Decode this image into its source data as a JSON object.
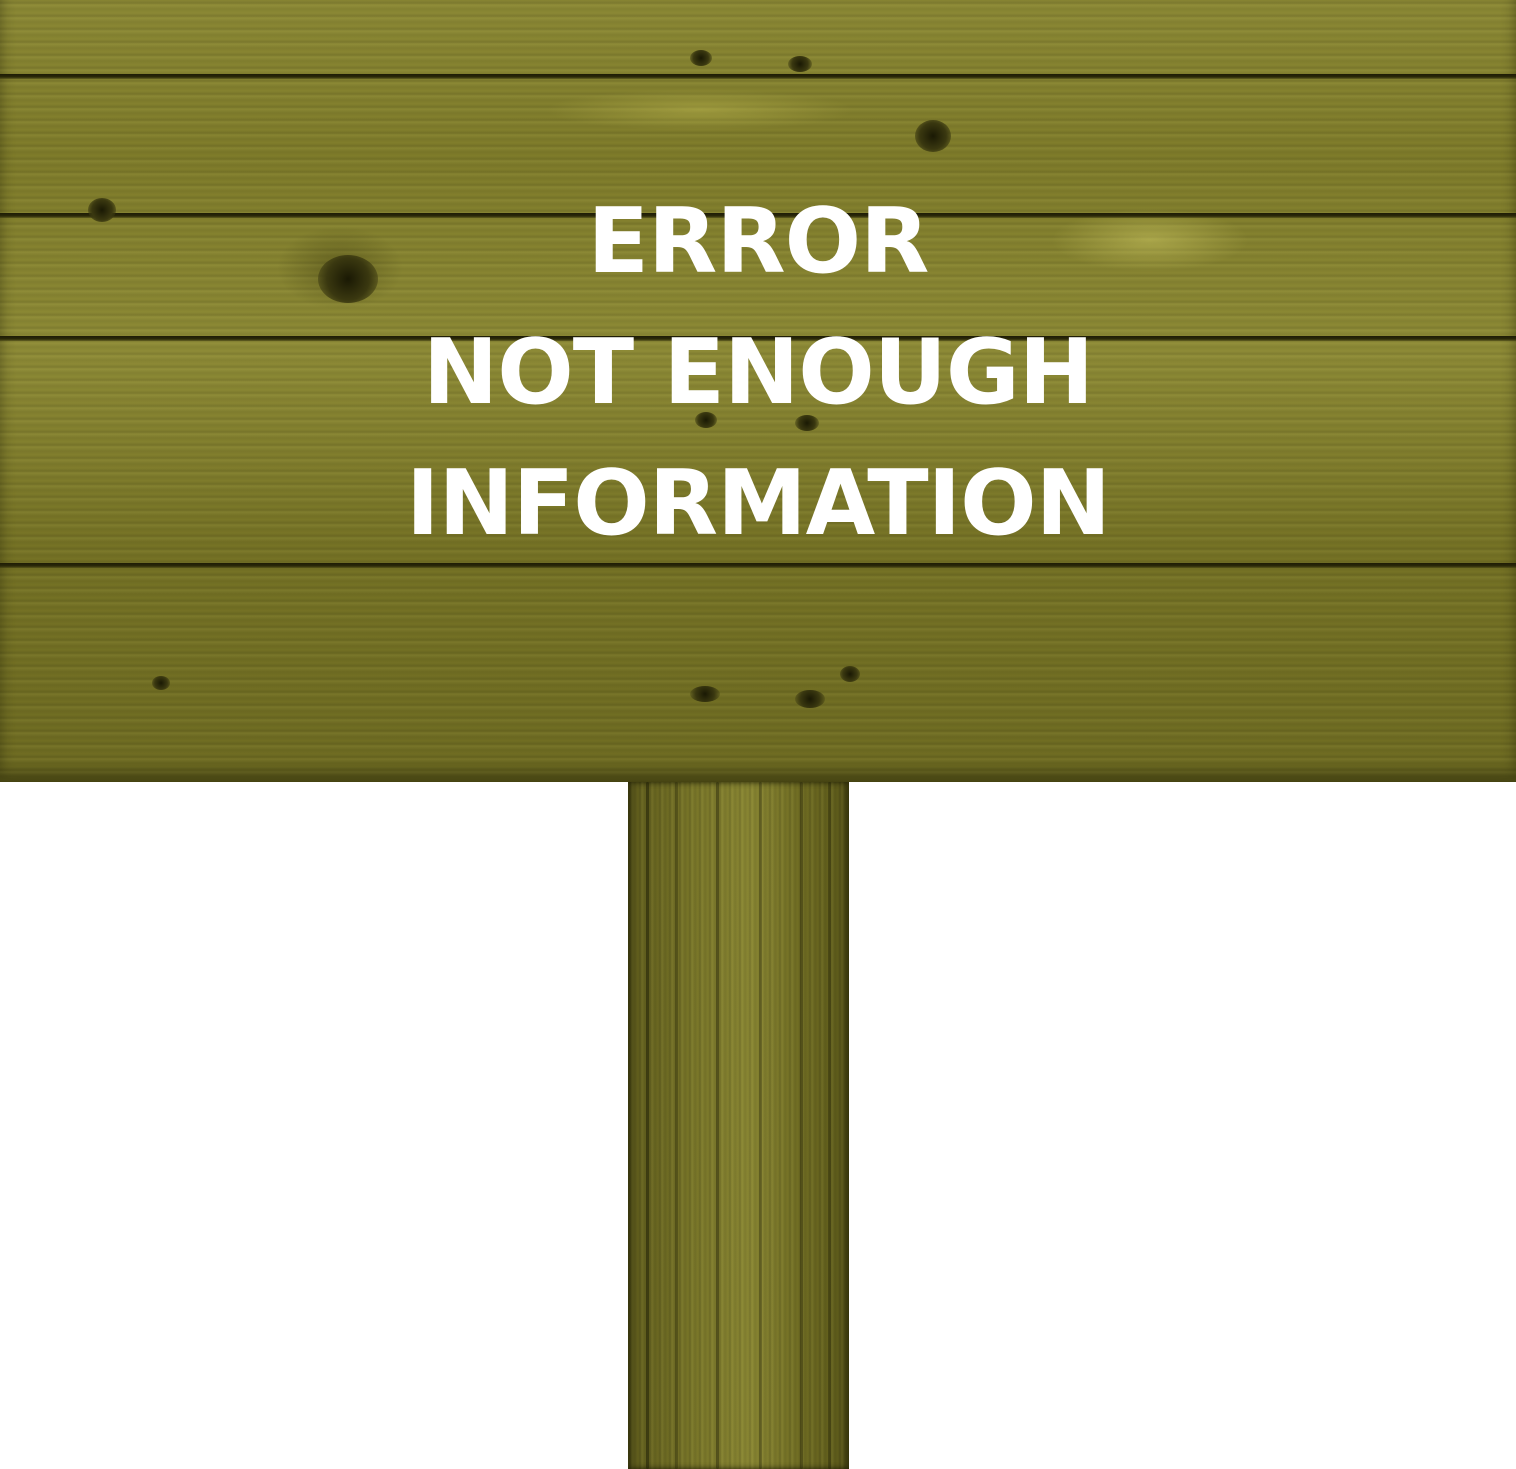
{
  "sign": {
    "line1": "ERROR",
    "line2": "NOT ENOUGH",
    "line3": "INFORMATION"
  },
  "colors": {
    "wood": "#8a8733",
    "text": "#ffffff",
    "background": "#ffffff"
  }
}
